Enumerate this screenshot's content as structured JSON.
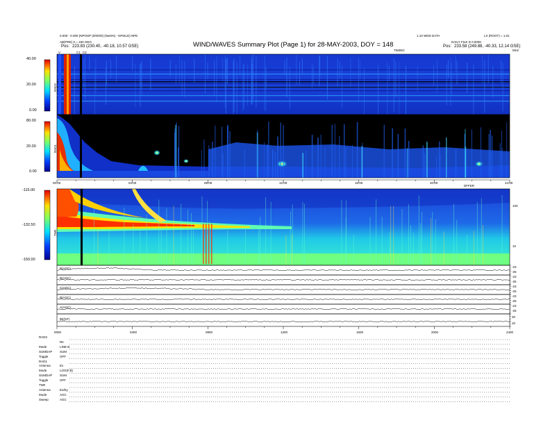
{
  "header": {
    "title": "WIND/WAVES Summary Plot (Page 1) for 28-MAY-2003, DOY = 148",
    "top_left_line1": "0.000 - 0.000 (NPOSP (0/0/0/0) (NaN%) - NFIELD) NPE",
    "top_left_line2": "AB(PRE) 0 = 150 GEO",
    "pos_left_label": "Pos:",
    "pos_left_value": "223.83 (230.40, -40.18, 10.57 GSE)",
    "top_right_line1": "LX (ROOT) = 1.01",
    "top_right_mid": "1.10 WDD DATA",
    "top_right_line2": "DAILY FILE D 0.0000",
    "pos_right_label": "Pos:",
    "pos_right_value": "233.58 (249.88, -40.33, 12.14 GSE)",
    "timing_label": "TIMING",
    "corner_mhz": "MHz",
    "corner_v": "V",
    "corner_c1": "C1",
    "corner_c2": "C2"
  },
  "rad2": {
    "label": "RAD2",
    "ticks": [
      "40.00",
      "20.00",
      "0.00"
    ]
  },
  "rad1": {
    "label": "RAD1",
    "ticks": [
      "80.00",
      "20.00",
      "0.00"
    ]
  },
  "tnr": {
    "label": "TNR",
    "ticks": [
      "-115.00",
      "-132.50",
      "-150.00"
    ],
    "right_ticks": [
      "100",
      "10"
    ],
    "corner_label": "DFFER"
  },
  "time_axis": {
    "labels": [
      "00:00",
      "04:00",
      "08:00",
      "12:00",
      "16:00",
      "20:00",
      "24:00"
    ]
  },
  "lines": {
    "labels": [
      "B(AGC)",
      "B(AGC)",
      "C(AGC)",
      "B(AGC)",
      "A(AGC)",
      "|B|(NT)"
    ],
    "right_ticks": [
      [
        "-23",
        "-25"
      ],
      [
        "-23",
        "-25"
      ],
      [
        "-23",
        "-25"
      ],
      [
        "-23",
        "-25"
      ],
      [
        "-23",
        "-25"
      ],
      [
        "20",
        "10"
      ]
    ]
  },
  "bottom_axis": {
    "labels": [
      "0000",
      "0400",
      "0800",
      "1200",
      "1600",
      "2000",
      "2400"
    ]
  },
  "footer": {
    "sections": [
      {
        "title": "RAD2",
        "rows": [
          [
            "",
            "Re"
          ],
          [
            "Mode",
            "LINE B"
          ],
          [
            "SUMDAP",
            "SUM"
          ],
          [
            "Toggle",
            "OFF"
          ]
        ]
      },
      {
        "title": "RAD1",
        "rows": [
          [
            "Antenna",
            "Ex"
          ],
          [
            "Mode",
            "LOG(F.B)"
          ],
          [
            "SUMDAP",
            "SUM"
          ],
          [
            "Toggle",
            "OFF"
          ]
        ]
      },
      {
        "title": "TNR",
        "rows": [
          [
            "Antenna",
            "Ex/Ey"
          ],
          [
            "Mode",
            "AGC"
          ],
          [
            "Sweep",
            "AGC"
          ]
        ]
      }
    ]
  },
  "colors": {
    "bg_blue": "#1532cc",
    "black": "#000000"
  },
  "chart_data": {
    "type": "heatmap",
    "title": "WIND/WAVES Summary Plot (Page 1) for 28-MAY-2003, DOY = 148",
    "x_range": [
      "00:00",
      "24:00"
    ],
    "panels": [
      {
        "name": "RAD2",
        "ylim": [
          0,
          40
        ]
      },
      {
        "name": "RAD1",
        "ylim": [
          0,
          80
        ]
      },
      {
        "name": "TNR",
        "ylim": [
          -150,
          -115
        ]
      }
    ]
  }
}
